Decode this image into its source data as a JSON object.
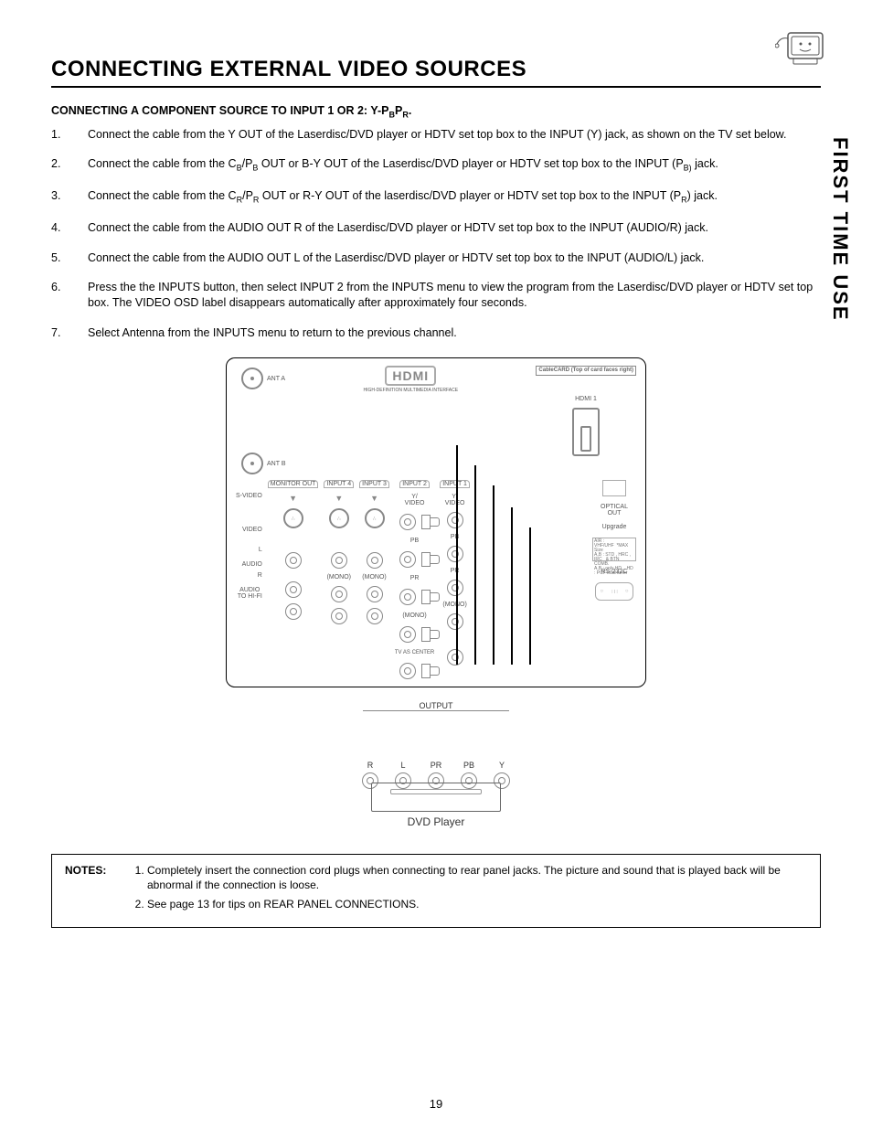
{
  "sideTab": "FIRST TIME USE",
  "title": "CONNECTING EXTERNAL VIDEO SOURCES",
  "subhead": {
    "prefix": "CONNECTING A COMPONENT SOURCE TO INPUT 1 OR 2:  Y-P",
    "sub1": "B",
    "mid": "P",
    "sub2": "R",
    "suffix": "."
  },
  "steps": [
    {
      "n": "1.",
      "text": "Connect the cable from the Y OUT of the Laserdisc/DVD player or HDTV set top box to the INPUT (Y) jack, as shown on the TV set below."
    },
    {
      "n": "2.",
      "html": "Connect the cable from the C<sub>B</sub>/P<sub>B</sub> OUT or B-Y OUT of the Laserdisc/DVD  player or HDTV set top box to the INPUT (P<sub>B)</sub> jack."
    },
    {
      "n": "3.",
      "html": "Connect the cable from the C<sub>R</sub>/P<sub>R</sub> OUT or R-Y OUT of the laserdisc/DVD player or HDTV set top box to the INPUT (P<sub>R</sub>) jack."
    },
    {
      "n": "4.",
      "text": "Connect the cable from the AUDIO OUT R of the Laserdisc/DVD player or   HDTV set top box to the INPUT (AUDIO/R) jack."
    },
    {
      "n": "5.",
      "text": "Connect the cable from the AUDIO OUT L of the Laserdisc/DVD player or HDTV set top box to the INPUT (AUDIO/L) jack."
    },
    {
      "n": "6.",
      "text": "Press the the INPUTS button, then select INPUT 2 from the INPUTS menu to view the program from the Laserdisc/DVD player or HDTV set top box.  The VIDEO OSD label disappears automatically after approximately four seconds."
    },
    {
      "n": "7.",
      "text": "Select Antenna from the INPUTS menu to return to the previous channel."
    }
  ],
  "diagram": {
    "antA": "ANT A",
    "antB": "ANT B",
    "monitorOut": "MONITOR OUT",
    "input4": "INPUT 4",
    "input3": "INPUT 3",
    "input2": "INPUT 2",
    "input1": "INPUT 1",
    "yvideo": "Y/\nVIDEO",
    "pb": "PB",
    "pr": "PR",
    "mono": "(MONO)",
    "svideo": "S-VIDEO",
    "video": "VIDEO",
    "audio": "AUDIO",
    "L": "L",
    "R": "R",
    "audioToHifi": "AUDIO\nTO HI-FI",
    "tvAsCenter": "TV AS CENTER",
    "hdmi": "HDMI",
    "hdmi1": "HDMI 1",
    "cablecard": "CableCARD\n(Top of card faces right)",
    "optical": "OPTICAL\nOUT",
    "upgrade": "Upgrade",
    "rs232c": "RS-232C",
    "outputTitle": "OUTPUT",
    "outputs": [
      "R",
      "L",
      "PR",
      "PB",
      "Y"
    ],
    "dvd": "DVD Player"
  },
  "notes": {
    "label": "NOTES:",
    "items": [
      "Completely insert the connection cord plugs when connecting to rear panel jacks.  The picture and sound that is played back will be abnormal if the connection is loose.",
      "See page 13 for tips on REAR PANEL CONNECTIONS."
    ]
  },
  "pageNumber": "19"
}
